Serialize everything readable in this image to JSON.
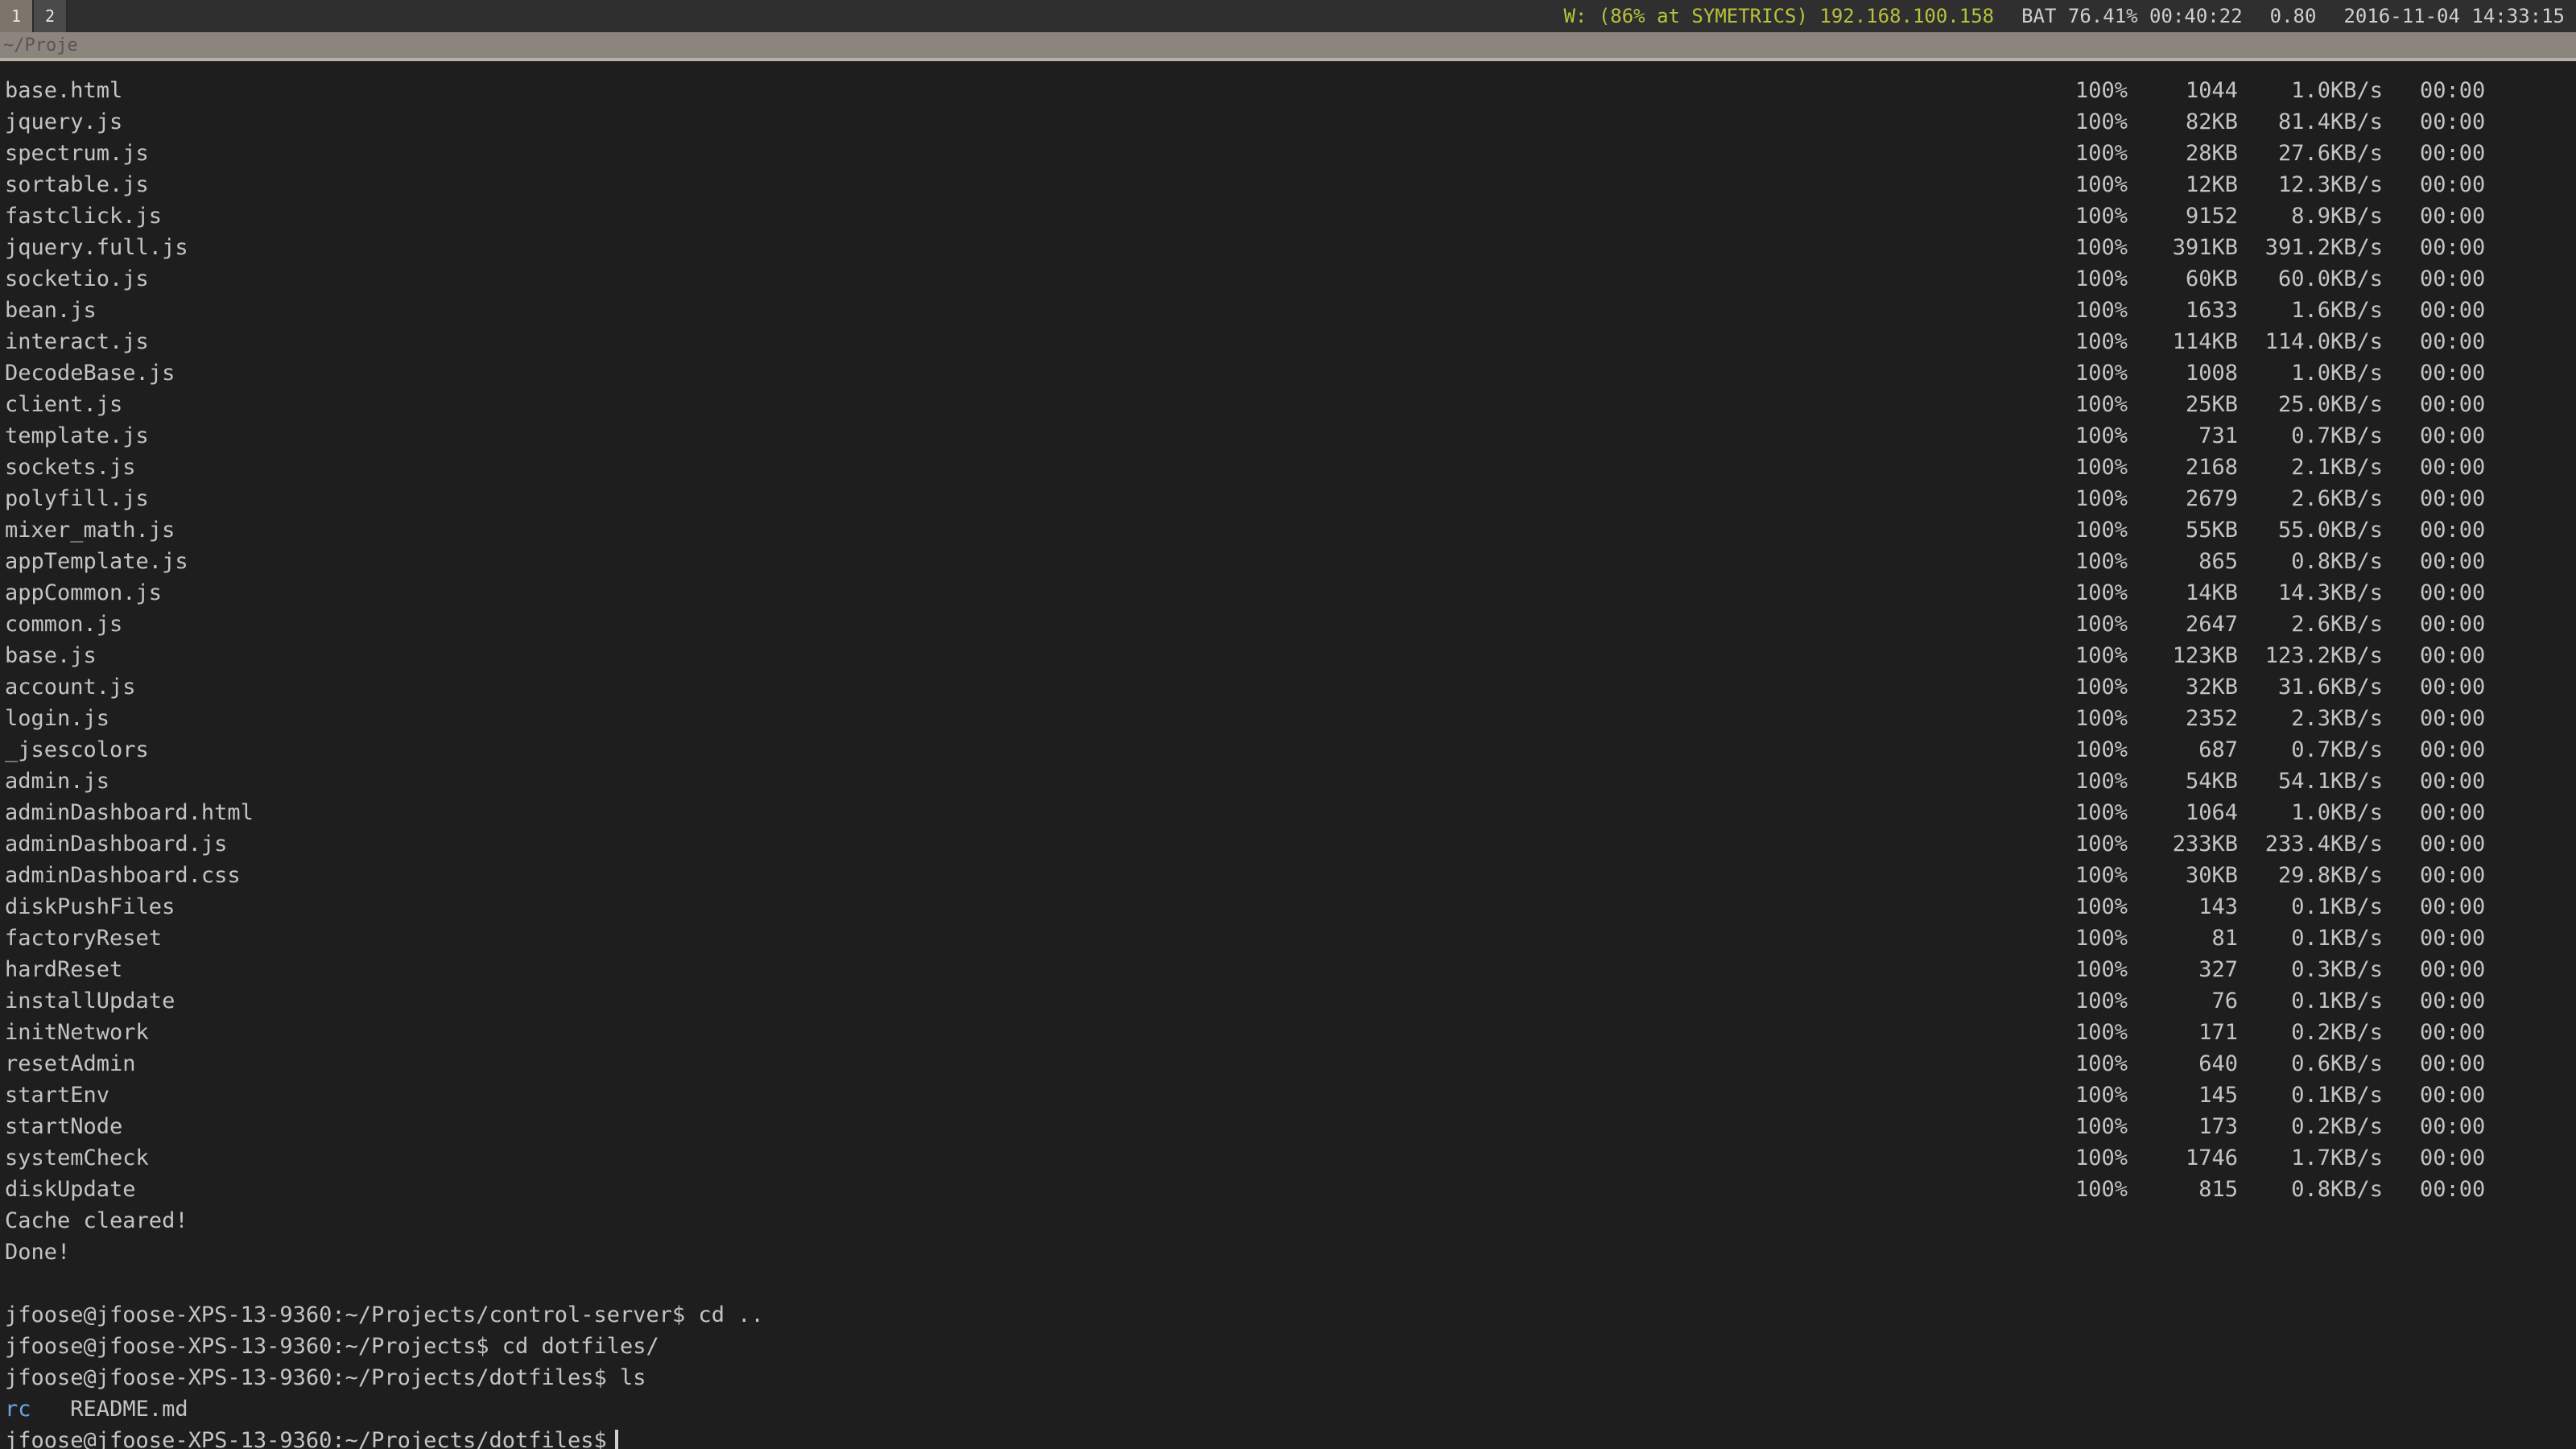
{
  "topbar": {
    "workspaces": [
      "1",
      "2"
    ],
    "wifi_status": "W: (86% at SYMETRICS) 192.168.100.158",
    "battery": "BAT 76.41% 00:40:22",
    "load": "0.80",
    "datetime": "2016-11-04 14:33:15"
  },
  "window": {
    "title": "~/Proje"
  },
  "transfers": [
    {
      "file": "base.html",
      "pct": "100%",
      "size": "1044",
      "rate": "1.0KB/s",
      "eta": "00:00"
    },
    {
      "file": "jquery.js",
      "pct": "100%",
      "size": "82KB",
      "rate": "81.4KB/s",
      "eta": "00:00"
    },
    {
      "file": "spectrum.js",
      "pct": "100%",
      "size": "28KB",
      "rate": "27.6KB/s",
      "eta": "00:00"
    },
    {
      "file": "sortable.js",
      "pct": "100%",
      "size": "12KB",
      "rate": "12.3KB/s",
      "eta": "00:00"
    },
    {
      "file": "fastclick.js",
      "pct": "100%",
      "size": "9152",
      "rate": "8.9KB/s",
      "eta": "00:00"
    },
    {
      "file": "jquery.full.js",
      "pct": "100%",
      "size": "391KB",
      "rate": "391.2KB/s",
      "eta": "00:00"
    },
    {
      "file": "socketio.js",
      "pct": "100%",
      "size": "60KB",
      "rate": "60.0KB/s",
      "eta": "00:00"
    },
    {
      "file": "bean.js",
      "pct": "100%",
      "size": "1633",
      "rate": "1.6KB/s",
      "eta": "00:00"
    },
    {
      "file": "interact.js",
      "pct": "100%",
      "size": "114KB",
      "rate": "114.0KB/s",
      "eta": "00:00"
    },
    {
      "file": "DecodeBase.js",
      "pct": "100%",
      "size": "1008",
      "rate": "1.0KB/s",
      "eta": "00:00"
    },
    {
      "file": "client.js",
      "pct": "100%",
      "size": "25KB",
      "rate": "25.0KB/s",
      "eta": "00:00"
    },
    {
      "file": "template.js",
      "pct": "100%",
      "size": "731",
      "rate": "0.7KB/s",
      "eta": "00:00"
    },
    {
      "file": "sockets.js",
      "pct": "100%",
      "size": "2168",
      "rate": "2.1KB/s",
      "eta": "00:00"
    },
    {
      "file": "polyfill.js",
      "pct": "100%",
      "size": "2679",
      "rate": "2.6KB/s",
      "eta": "00:00"
    },
    {
      "file": "mixer_math.js",
      "pct": "100%",
      "size": "55KB",
      "rate": "55.0KB/s",
      "eta": "00:00"
    },
    {
      "file": "appTemplate.js",
      "pct": "100%",
      "size": "865",
      "rate": "0.8KB/s",
      "eta": "00:00"
    },
    {
      "file": "appCommon.js",
      "pct": "100%",
      "size": "14KB",
      "rate": "14.3KB/s",
      "eta": "00:00"
    },
    {
      "file": "common.js",
      "pct": "100%",
      "size": "2647",
      "rate": "2.6KB/s",
      "eta": "00:00"
    },
    {
      "file": "base.js",
      "pct": "100%",
      "size": "123KB",
      "rate": "123.2KB/s",
      "eta": "00:00"
    },
    {
      "file": "account.js",
      "pct": "100%",
      "size": "32KB",
      "rate": "31.6KB/s",
      "eta": "00:00"
    },
    {
      "file": "login.js",
      "pct": "100%",
      "size": "2352",
      "rate": "2.3KB/s",
      "eta": "00:00"
    },
    {
      "file": "_jsescolors",
      "pct": "100%",
      "size": "687",
      "rate": "0.7KB/s",
      "eta": "00:00"
    },
    {
      "file": "admin.js",
      "pct": "100%",
      "size": "54KB",
      "rate": "54.1KB/s",
      "eta": "00:00"
    },
    {
      "file": "adminDashboard.html",
      "pct": "100%",
      "size": "1064",
      "rate": "1.0KB/s",
      "eta": "00:00"
    },
    {
      "file": "adminDashboard.js",
      "pct": "100%",
      "size": "233KB",
      "rate": "233.4KB/s",
      "eta": "00:00"
    },
    {
      "file": "adminDashboard.css",
      "pct": "100%",
      "size": "30KB",
      "rate": "29.8KB/s",
      "eta": "00:00"
    },
    {
      "file": "diskPushFiles",
      "pct": "100%",
      "size": "143",
      "rate": "0.1KB/s",
      "eta": "00:00"
    },
    {
      "file": "factoryReset",
      "pct": "100%",
      "size": "81",
      "rate": "0.1KB/s",
      "eta": "00:00"
    },
    {
      "file": "hardReset",
      "pct": "100%",
      "size": "327",
      "rate": "0.3KB/s",
      "eta": "00:00"
    },
    {
      "file": "installUpdate",
      "pct": "100%",
      "size": "76",
      "rate": "0.1KB/s",
      "eta": "00:00"
    },
    {
      "file": "initNetwork",
      "pct": "100%",
      "size": "171",
      "rate": "0.2KB/s",
      "eta": "00:00"
    },
    {
      "file": "resetAdmin",
      "pct": "100%",
      "size": "640",
      "rate": "0.6KB/s",
      "eta": "00:00"
    },
    {
      "file": "startEnv",
      "pct": "100%",
      "size": "145",
      "rate": "0.1KB/s",
      "eta": "00:00"
    },
    {
      "file": "startNode",
      "pct": "100%",
      "size": "173",
      "rate": "0.2KB/s",
      "eta": "00:00"
    },
    {
      "file": "systemCheck",
      "pct": "100%",
      "size": "1746",
      "rate": "1.7KB/s",
      "eta": "00:00"
    },
    {
      "file": "diskUpdate",
      "pct": "100%",
      "size": "815",
      "rate": "0.8KB/s",
      "eta": "00:00"
    }
  ],
  "messages": {
    "cache": "Cache cleared!",
    "done": "Done!"
  },
  "prompts": [
    {
      "text": "jfoose@jfoose-XPS-13-9360:~/Projects/control-server$ cd .."
    },
    {
      "text": "jfoose@jfoose-XPS-13-9360:~/Projects$ cd dotfiles/"
    },
    {
      "text": "jfoose@jfoose-XPS-13-9360:~/Projects/dotfiles$ ls"
    }
  ],
  "ls_output": {
    "dir": "rc",
    "file": "README.md"
  },
  "current_prompt": "jfoose@jfoose-XPS-13-9360:~/Projects/dotfiles$"
}
